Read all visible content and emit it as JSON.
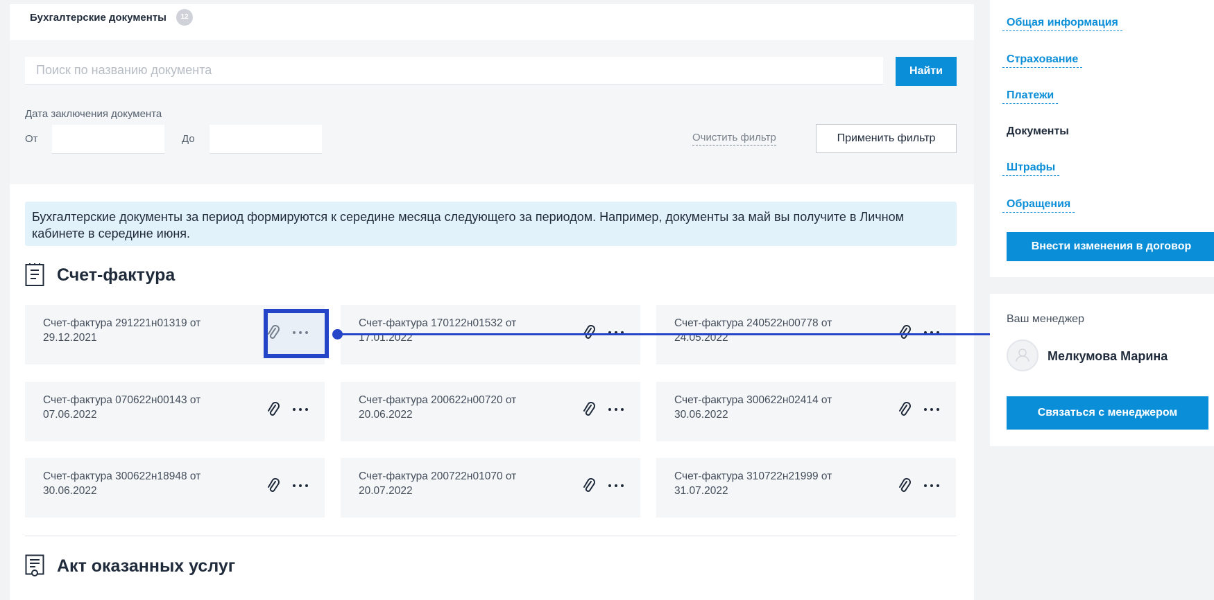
{
  "header": {
    "title": "Бухгалтерские документы",
    "count": "12"
  },
  "filter": {
    "search_placeholder": "Поиск по названию документа",
    "find_label": "Найти",
    "date_label": "Дата заключения документа",
    "from_label": "От",
    "to_label": "До",
    "clear_label": "Очистить фильтр",
    "apply_label": "Применить фильтр"
  },
  "info_text": "Бухгалтерские документы за период формируются к середине месяца следующего за периодом. Например, документы за май вы получите в Личном кабинете в середине июня.",
  "invoices": {
    "title": "Счет-фактура",
    "items": [
      "Счет-фактура 291221н01319 от 29.12.2021",
      "Счет-фактура 170122н01532 от 17.01.2022",
      "Счет-фактура 240522н00778 от 24.05.2022",
      "Счет-фактура 070622н00143 от 07.06.2022",
      "Счет-фактура 200622н00720 от 20.06.2022",
      "Счет-фактура 300622н02414 от 30.06.2022",
      "Счет-фактура 300622н18948 от 30.06.2022",
      "Счет-фактура 200722н01070 от 20.07.2022",
      "Счет-фактура 310722н21999 от 31.07.2022"
    ]
  },
  "acts": {
    "title": "Акт оказанных услуг"
  },
  "sidebar": {
    "nav": [
      "Общая информация",
      "Страхование",
      "Платежи",
      "Документы",
      "Штрафы",
      "Обращения"
    ],
    "contract_button": "Внести изменения в договор"
  },
  "manager": {
    "label": "Ваш менеджер",
    "name": "Мелкумова Марина",
    "contact_button": "Связаться с менеджером"
  },
  "colors": {
    "accent": "#0a8ed8",
    "annotation": "#2445c8",
    "info_bg": "#e2f2fb"
  }
}
